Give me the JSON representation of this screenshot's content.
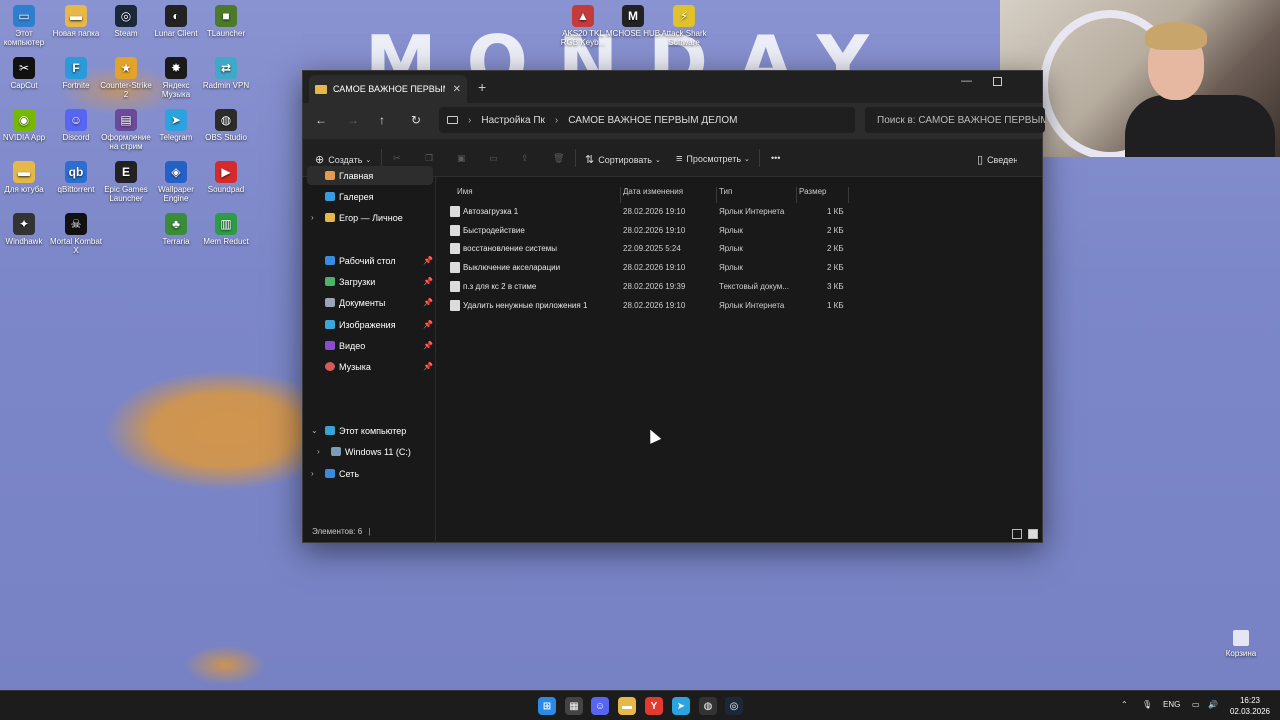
{
  "wallpaper": {
    "title": "MONDAY"
  },
  "desktop": {
    "icons": [
      {
        "label": "Этот компьютер",
        "color": "#2f7fd0",
        "glyph": "▭"
      },
      {
        "label": "Новая папка",
        "color": "#e6b84a",
        "glyph": "▬"
      },
      {
        "label": "Steam",
        "color": "#1b2838",
        "glyph": "◎"
      },
      {
        "label": "Lunar Client",
        "color": "#222",
        "glyph": "◐"
      },
      {
        "label": "TLauncher",
        "color": "#4c7a2a",
        "glyph": "■"
      },
      {
        "label": "CapCut",
        "color": "#111",
        "glyph": "✂"
      },
      {
        "label": "Fortnite",
        "color": "#2a9ad8",
        "glyph": "F"
      },
      {
        "label": "Counter-Strike 2",
        "color": "#e2a32a",
        "glyph": "★"
      },
      {
        "label": "Яндекс Музыка",
        "color": "#1a1a1a",
        "glyph": "✸"
      },
      {
        "label": "Radmin VPN",
        "color": "#3fa9c9",
        "glyph": "⇄"
      },
      {
        "label": "NVIDIA App",
        "color": "#76b900",
        "glyph": "◉"
      },
      {
        "label": "Discord",
        "color": "#5865f2",
        "glyph": "☺"
      },
      {
        "label": "Оформление на стрим",
        "color": "#6a4b9b",
        "glyph": "▤"
      },
      {
        "label": "Telegram",
        "color": "#2aa3de",
        "glyph": "➤"
      },
      {
        "label": "OBS Studio",
        "color": "#2b2b2b",
        "glyph": "◍"
      },
      {
        "label": "Для ютуба",
        "color": "#e6b84a",
        "glyph": "▬"
      },
      {
        "label": "qBittorrent",
        "color": "#2c6fd1",
        "glyph": "qb"
      },
      {
        "label": "Epic Games Launcher",
        "color": "#222",
        "glyph": "E"
      },
      {
        "label": "Wallpaper Engine",
        "color": "#2461c7",
        "glyph": "◈"
      },
      {
        "label": "Soundpad",
        "color": "#d62b2b",
        "glyph": "▶"
      },
      {
        "label": "Windhawk",
        "color": "#333",
        "glyph": "✦"
      },
      {
        "label": "Mortal Kombat X",
        "color": "#111",
        "glyph": "☠"
      },
      {
        "label": "Terraria",
        "color": "#3a8c3a",
        "glyph": "♣"
      },
      {
        "label": "Mem Reduct",
        "color": "#2e9b46",
        "glyph": "▥"
      },
      {
        "label": "AKS20 TKL RGB Keyb...",
        "color": "#c53a3a",
        "glyph": "▲"
      },
      {
        "label": "MCHOSE HUB",
        "color": "#222",
        "glyph": "M"
      },
      {
        "label": "Attack Shark Software",
        "color": "#e0c22a",
        "glyph": "⚡"
      }
    ],
    "recycle_bin": "Корзина"
  },
  "explorer": {
    "tab_title": "САМОЕ ВАЖНОЕ ПЕРВЫМ ДЕЛОМ",
    "new_tab": "+",
    "breadcrumb": [
      "Настройка Пк",
      "САМОЕ ВАЖНОЕ ПЕРВЫМ ДЕЛОМ"
    ],
    "search_placeholder": "Поиск в: САМОЕ ВАЖНОЕ ПЕРВЫМ ДЕЛОМ",
    "toolbar": {
      "create": "Создать",
      "sort": "Сортировать",
      "view": "Просмотреть",
      "more": "•••",
      "details": "Сведения"
    },
    "nav": {
      "home": "Главная",
      "gallery": "Галерея",
      "personal": "Егор — Личное",
      "desktop": "Рабочий стол",
      "downloads": "Загрузки",
      "documents": "Документы",
      "pictures": "Изображения",
      "videos": "Видео",
      "music": "Музыка",
      "this_pc": "Этот компьютер",
      "drive": "Windows 11 (C:)",
      "network": "Сеть"
    },
    "columns": {
      "name": "Имя",
      "date": "Дата изменения",
      "type": "Тип",
      "size": "Размер"
    },
    "files": [
      {
        "name": "Автозагрузка 1",
        "date": "28.02.2026 19:10",
        "type": "Ярлык Интернета",
        "size": "1 КБ"
      },
      {
        "name": "Быстродействие",
        "date": "28.02.2026 19:10",
        "type": "Ярлык",
        "size": "2 КБ"
      },
      {
        "name": "восстановление системы",
        "date": "22.09.2025 5:24",
        "type": "Ярлык",
        "size": "2 КБ"
      },
      {
        "name": "Выключение акселарации",
        "date": "28.02.2026 19:10",
        "type": "Ярлык",
        "size": "2 КБ"
      },
      {
        "name": "п.з для кс 2 в стиме",
        "date": "28.02.2026 19:39",
        "type": "Текстовый докум...",
        "size": "3 КБ"
      },
      {
        "name": "Удалить ненужные приложения 1",
        "date": "28.02.2026 19:10",
        "type": "Ярлык Интернета",
        "size": "1 КБ"
      }
    ],
    "status": "Элементов: 6"
  },
  "taskbar": {
    "apps": [
      {
        "name": "start-icon",
        "color": "#2a8ae6",
        "glyph": "⊞"
      },
      {
        "name": "calculator-icon",
        "color": "#444",
        "glyph": "▦"
      },
      {
        "name": "discord-icon",
        "color": "#5865f2",
        "glyph": "☺"
      },
      {
        "name": "file-explorer-icon",
        "color": "#e6b84a",
        "glyph": "▬"
      },
      {
        "name": "yandex-browser-icon",
        "color": "#e23a2e",
        "glyph": "Y"
      },
      {
        "name": "telegram-icon",
        "color": "#2aa3de",
        "glyph": "➤"
      },
      {
        "name": "obs-icon",
        "color": "#333",
        "glyph": "◍"
      },
      {
        "name": "steam-icon",
        "color": "#1b2838",
        "glyph": "◎"
      }
    ],
    "language": "ENG",
    "time": "16:23",
    "date": "02.03.2026"
  }
}
